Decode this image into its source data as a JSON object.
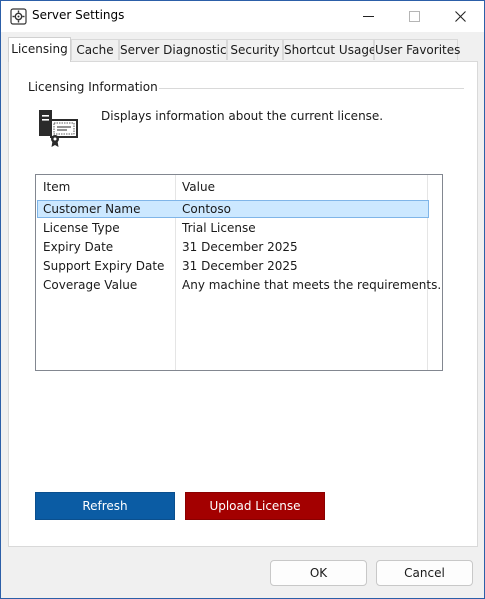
{
  "window": {
    "title": "Server Settings",
    "icon": "settings-gear-icon"
  },
  "tabs": [
    {
      "label": "Licensing",
      "active": true
    },
    {
      "label": "Cache",
      "active": false
    },
    {
      "label": "Server Diagnostics",
      "active": false
    },
    {
      "label": "Security",
      "active": false
    },
    {
      "label": "Shortcut Usage",
      "active": false
    },
    {
      "label": "User Favorites",
      "active": false
    }
  ],
  "licensing": {
    "group_label": "Licensing Information",
    "description": "Displays information about the current license.",
    "icon": "certificate-server-icon",
    "columns": [
      "Item",
      "Value"
    ],
    "rows": [
      {
        "item": "Customer Name",
        "value": "Contoso",
        "selected": true
      },
      {
        "item": "License Type",
        "value": "Trial License",
        "selected": false
      },
      {
        "item": "Expiry Date",
        "value": "31 December 2025",
        "selected": false
      },
      {
        "item": "Support Expiry Date",
        "value": "31 December 2025",
        "selected": false
      },
      {
        "item": "Coverage Value",
        "value": "Any machine that meets the requirements.",
        "selected": false
      }
    ],
    "refresh_label": "Refresh",
    "upload_label": "Upload License"
  },
  "dialog": {
    "ok_label": "OK",
    "cancel_label": "Cancel"
  },
  "colors": {
    "refresh_button": "#0b5ca4",
    "upload_button": "#a30000",
    "selection": "#cce8ff"
  }
}
